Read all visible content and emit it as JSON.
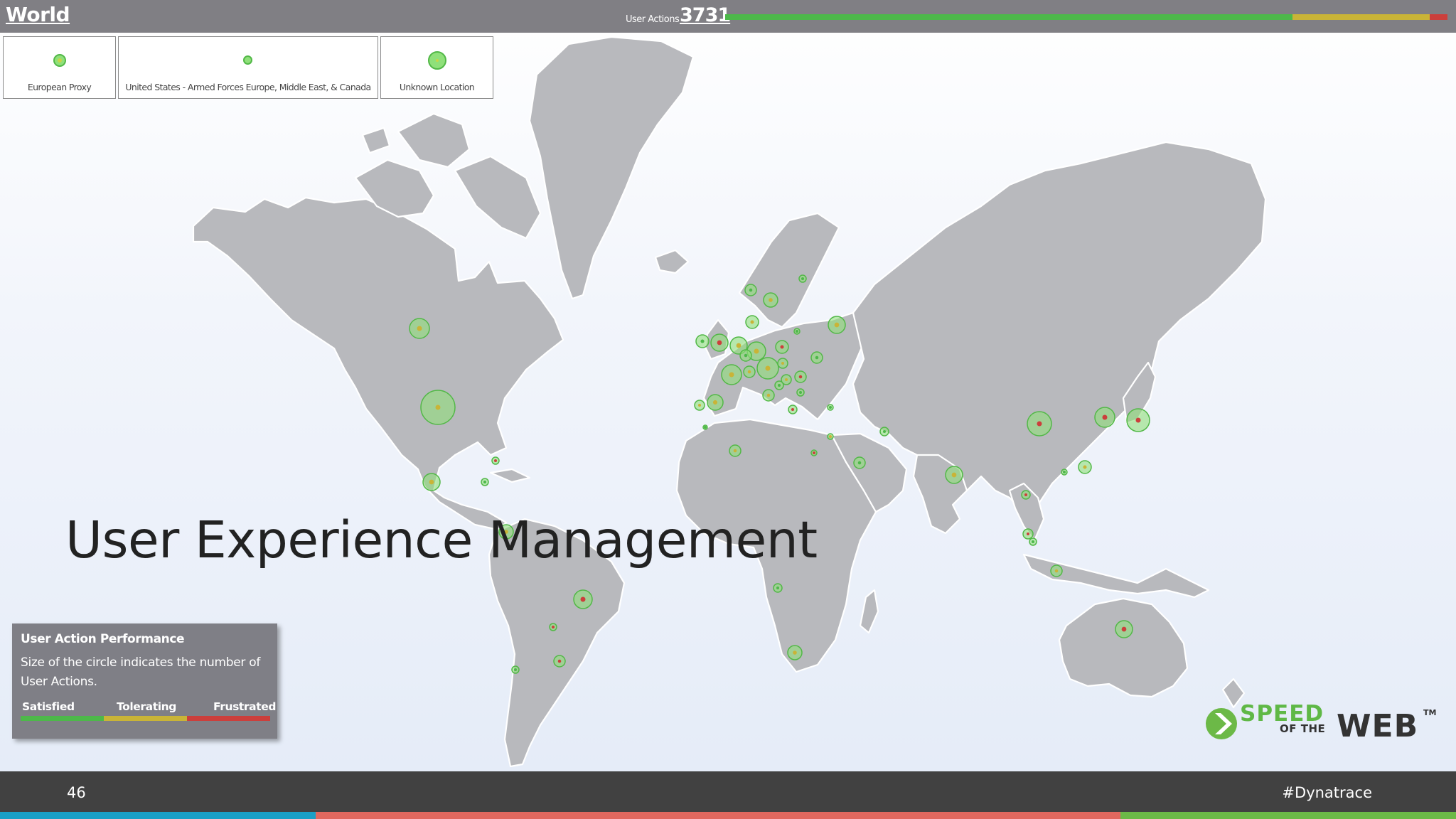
{
  "header": {
    "title": "World",
    "user_actions_label": "User Actions",
    "user_actions_count": "3731",
    "performance_split": {
      "satisfied": 0.785,
      "tolerating": 0.19,
      "frustrated": 0.025
    }
  },
  "locations": [
    {
      "label": "European Proxy"
    },
    {
      "label": "United States - Armed Forces Europe, Middle East, & Canada"
    },
    {
      "label": "Unknown Location"
    }
  ],
  "slide_title": "User Experience Management",
  "legend": {
    "title": "User Action Performance",
    "description": "Size of the circle indicates the number of User Actions.",
    "satisfied": "Satisfied",
    "tolerating": "Tolerating",
    "frustrated": "Frustrated"
  },
  "colors": {
    "satisfied": "#4db84a",
    "tolerating": "#c9b437",
    "frustrated": "#cc3f3c",
    "bubble_fill": "#8fe07a",
    "bubble_stroke": "#52b847"
  },
  "logo": {
    "speed": "SPEED",
    "of_the": "OF THE",
    "web": "WEB",
    "tm": "TM"
  },
  "footer": {
    "page_number": "46",
    "hashtag": "#Dynatrace",
    "stripe_colors": [
      "#1aa0c6",
      "#e0685f",
      "#6cb947"
    ]
  }
}
